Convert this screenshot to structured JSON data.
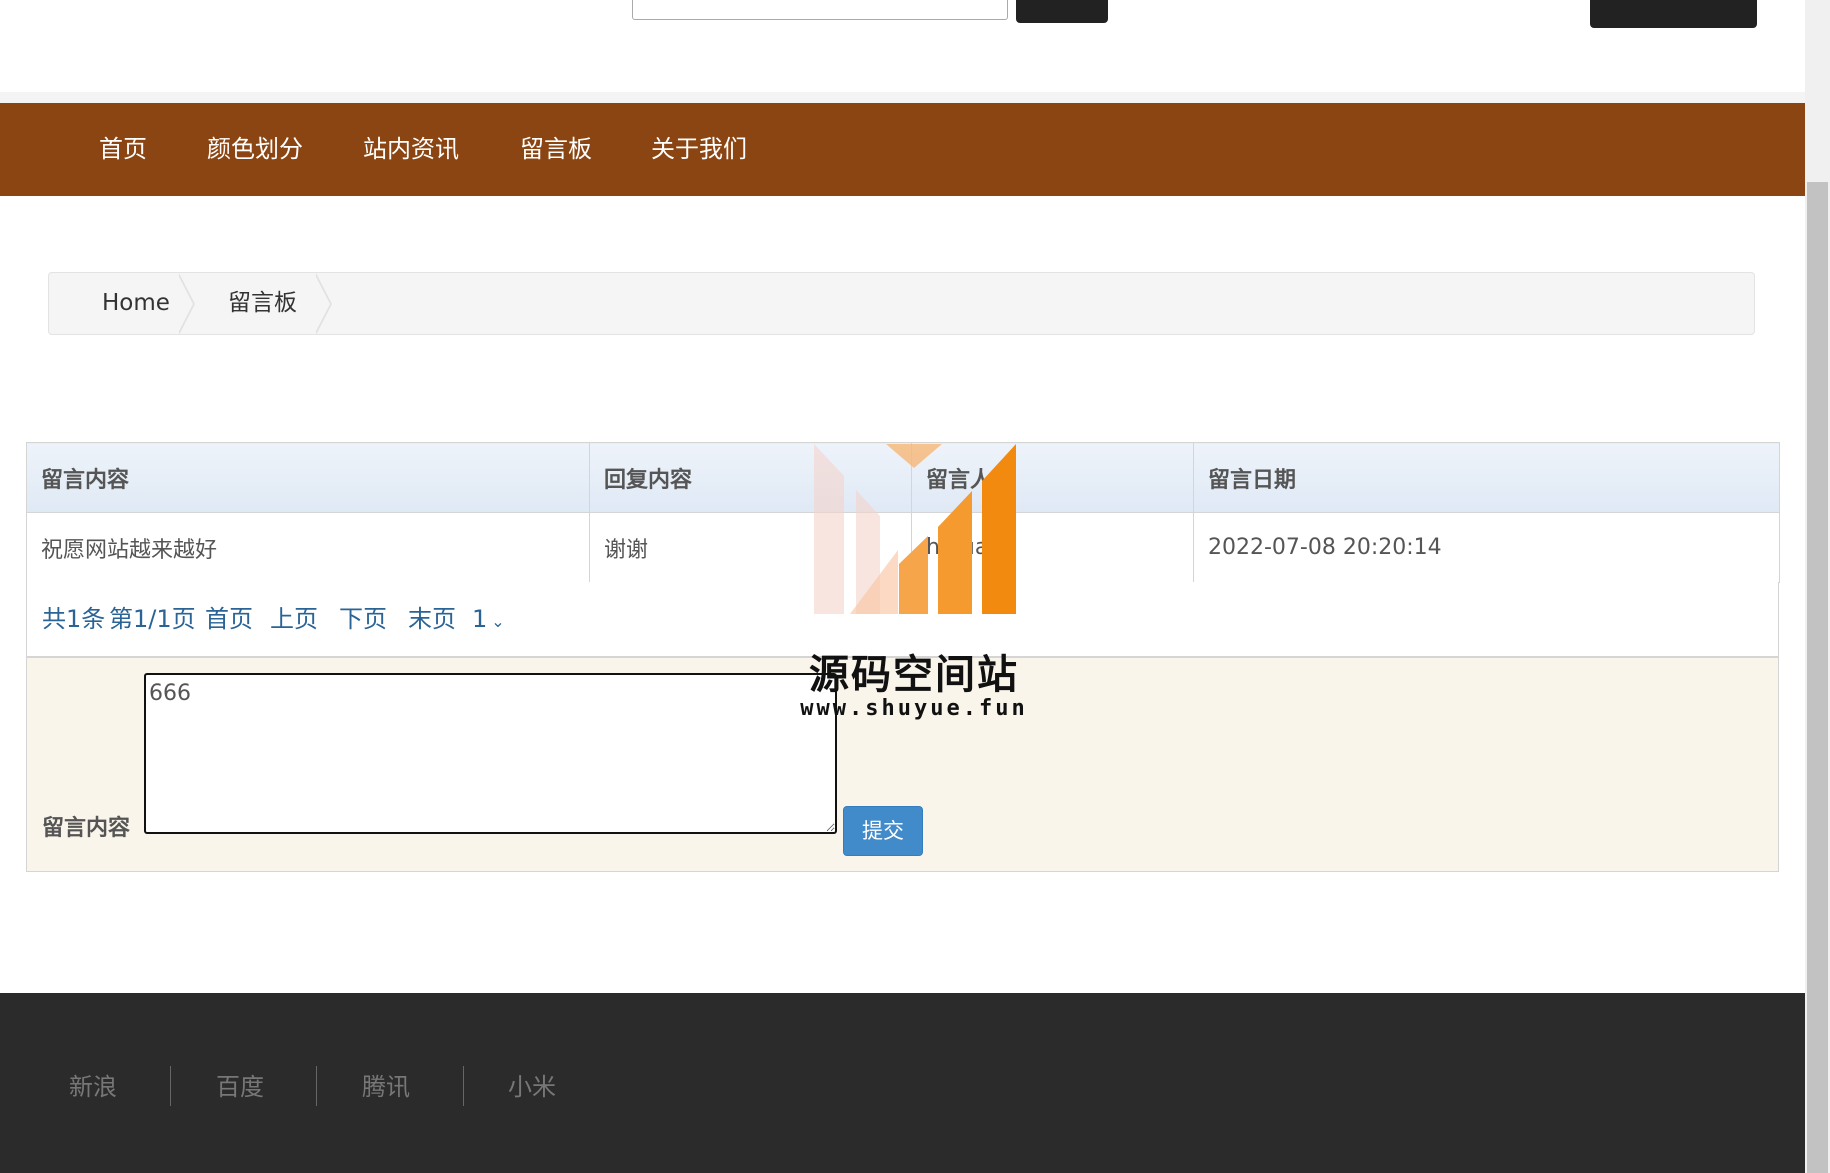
{
  "nav": {
    "items": [
      {
        "label": "首页"
      },
      {
        "label": "颜色划分"
      },
      {
        "label": "站内资讯"
      },
      {
        "label": "留言板"
      },
      {
        "label": "关于我们"
      }
    ]
  },
  "breadcrumb": {
    "items": [
      {
        "label": "Home"
      },
      {
        "label": "留言板"
      }
    ]
  },
  "table": {
    "headers": [
      "留言内容",
      "回复内容",
      "留言人",
      "留言日期"
    ],
    "rows": [
      [
        "祝愿网站越来越好",
        "谢谢",
        "hu ua",
        "2022-07-08 20:20:14"
      ]
    ]
  },
  "pager": {
    "total": "共1条",
    "page_info": "第1/1页",
    "first": "首页",
    "prev": "上页",
    "next": "下页",
    "last": "末页",
    "select": "1"
  },
  "form": {
    "label": "留言内容",
    "textarea_value": "666",
    "submit": "提交"
  },
  "watermark": {
    "title": "源码空间站",
    "url": "www.shuyue.fun"
  },
  "footer": {
    "links": [
      {
        "label": "新浪"
      },
      {
        "label": "百度"
      },
      {
        "label": "腾讯"
      },
      {
        "label": "小米"
      }
    ]
  },
  "colors": {
    "nav_bg": "#8b4513",
    "footer_bg": "#2b2b2b",
    "link": "#2a6496",
    "button": "#428bca",
    "form_bg": "#faf5eb"
  }
}
